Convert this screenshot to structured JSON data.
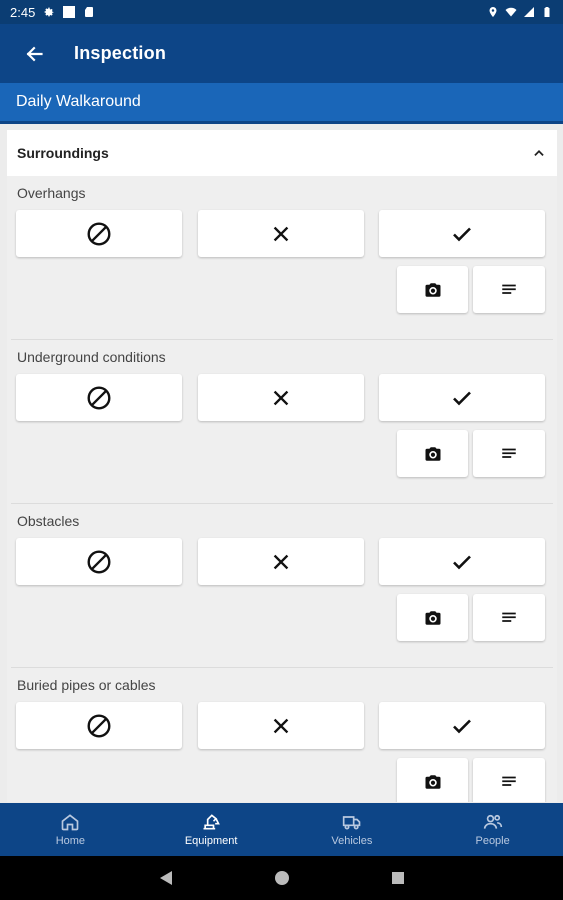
{
  "status_bar": {
    "time": "2:45",
    "icons": [
      "gear-icon",
      "square-icon",
      "sd-card-icon",
      "location-icon",
      "wifi-icon",
      "signal-icon",
      "battery-icon"
    ]
  },
  "app_bar": {
    "back_icon": "arrow-left-icon",
    "title": "Inspection"
  },
  "sub_header": {
    "title": "Daily Walkaround"
  },
  "section": {
    "title": "Surroundings",
    "toggle_icon": "chevron-up-icon",
    "items": [
      {
        "label": "Overhangs"
      },
      {
        "label": "Underground conditions"
      },
      {
        "label": "Obstacles"
      },
      {
        "label": "Buried pipes or cables"
      }
    ],
    "option_icons": [
      "not-applicable-icon",
      "cross-icon",
      "check-icon"
    ],
    "action_icons": [
      "camera-icon",
      "notes-icon"
    ]
  },
  "bottom_nav": {
    "items": [
      {
        "label": "Home",
        "icon": "home-icon",
        "active": false
      },
      {
        "label": "Equipment",
        "icon": "excavator-icon",
        "active": true
      },
      {
        "label": "Vehicles",
        "icon": "truck-icon",
        "active": false
      },
      {
        "label": "People",
        "icon": "people-icon",
        "active": false
      }
    ]
  },
  "system_nav": [
    "back-triangle-icon",
    "home-circle-icon",
    "recents-square-icon"
  ],
  "colors": {
    "app_bar": "#0d4587",
    "status_bar": "#0b3d73",
    "sub_header": "#1a66b8",
    "content_bg": "#efefef"
  }
}
